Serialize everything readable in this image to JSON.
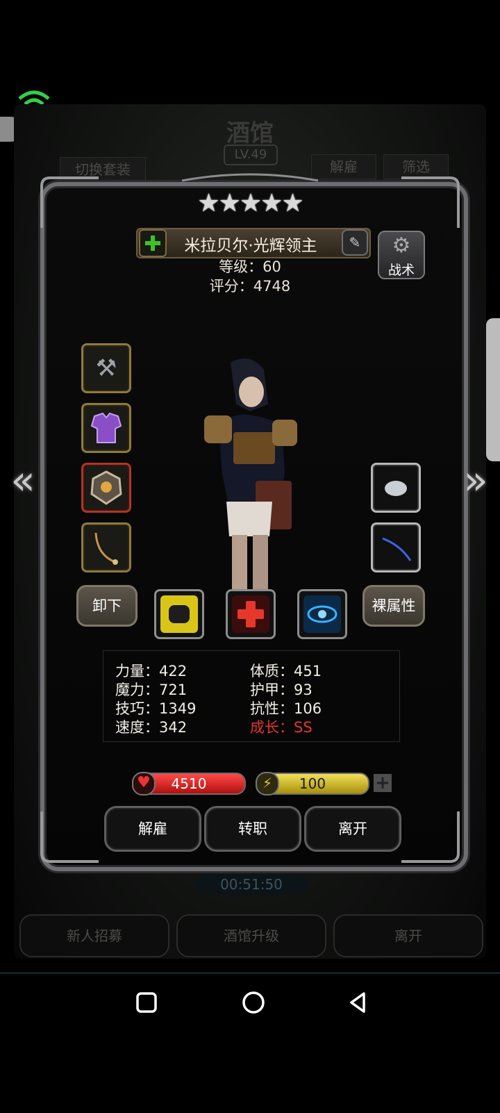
{
  "background": {
    "title": "酒馆",
    "level": "LV.49",
    "switch_outfit": "切换套装",
    "dismiss": "解雇",
    "filter": "筛选",
    "timer": "00:51:50",
    "bottom_buttons": [
      "新人招募",
      "酒馆升级",
      "离开"
    ]
  },
  "hero": {
    "stars": "★★★★★",
    "name": "米拉贝尔·光辉领主",
    "level_text": "等级：60",
    "score_text": "评分：4748",
    "tactics_label": "战术"
  },
  "actions": {
    "unequip": "卸下",
    "base_attr": "裸属性"
  },
  "stats": {
    "strength": "力量：422",
    "constitution": "体质：451",
    "magic": "魔力：721",
    "armor": "护甲：93",
    "skill": "技巧：1349",
    "resistance": "抗性：106",
    "speed": "速度：342",
    "growth": "成长：SS"
  },
  "bars": {
    "hp": "4510",
    "energy": "100"
  },
  "buttons": {
    "dismiss": "解雇",
    "change_class": "转职",
    "leave": "离开"
  },
  "icons": {
    "left_arrow": "double-chevron-left-icon",
    "right_arrow": "double-chevron-right-icon"
  },
  "colors": {
    "growth_red": "#e5352b",
    "hp_red": "#d42020",
    "energy_yellow": "#e0c830"
  }
}
